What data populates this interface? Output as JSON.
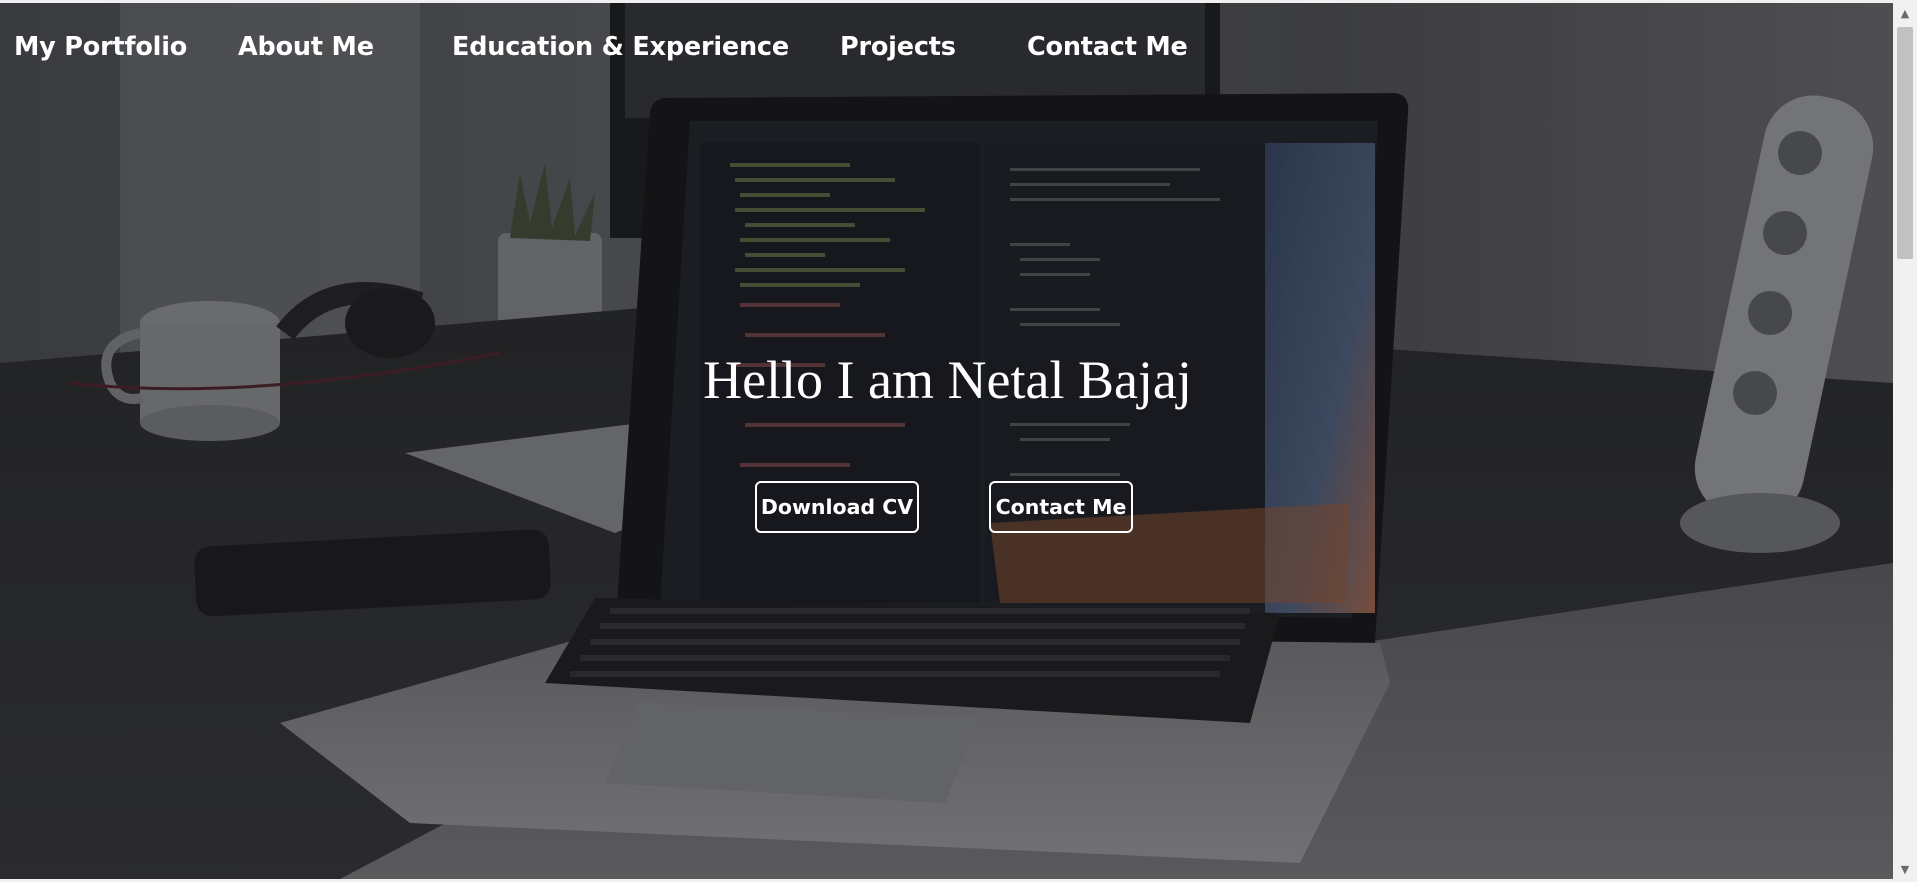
{
  "nav": {
    "brand": "My Portfolio",
    "items": [
      {
        "label": "About Me"
      },
      {
        "label": "Education & Experience"
      },
      {
        "label": "Projects"
      },
      {
        "label": "Contact Me"
      }
    ]
  },
  "hero": {
    "title": "Hello I am Netal Bajaj",
    "buttons": {
      "download_cv": "Download CV",
      "contact": "Contact Me"
    }
  },
  "background": {
    "icon": "laptop-desk-photo",
    "overlay_color": "#141416"
  },
  "colors": {
    "text": "#ffffff",
    "button_border": "#ffffff",
    "scrollbar_track": "#f1f1f1",
    "scrollbar_thumb": "#c1c1c1"
  }
}
